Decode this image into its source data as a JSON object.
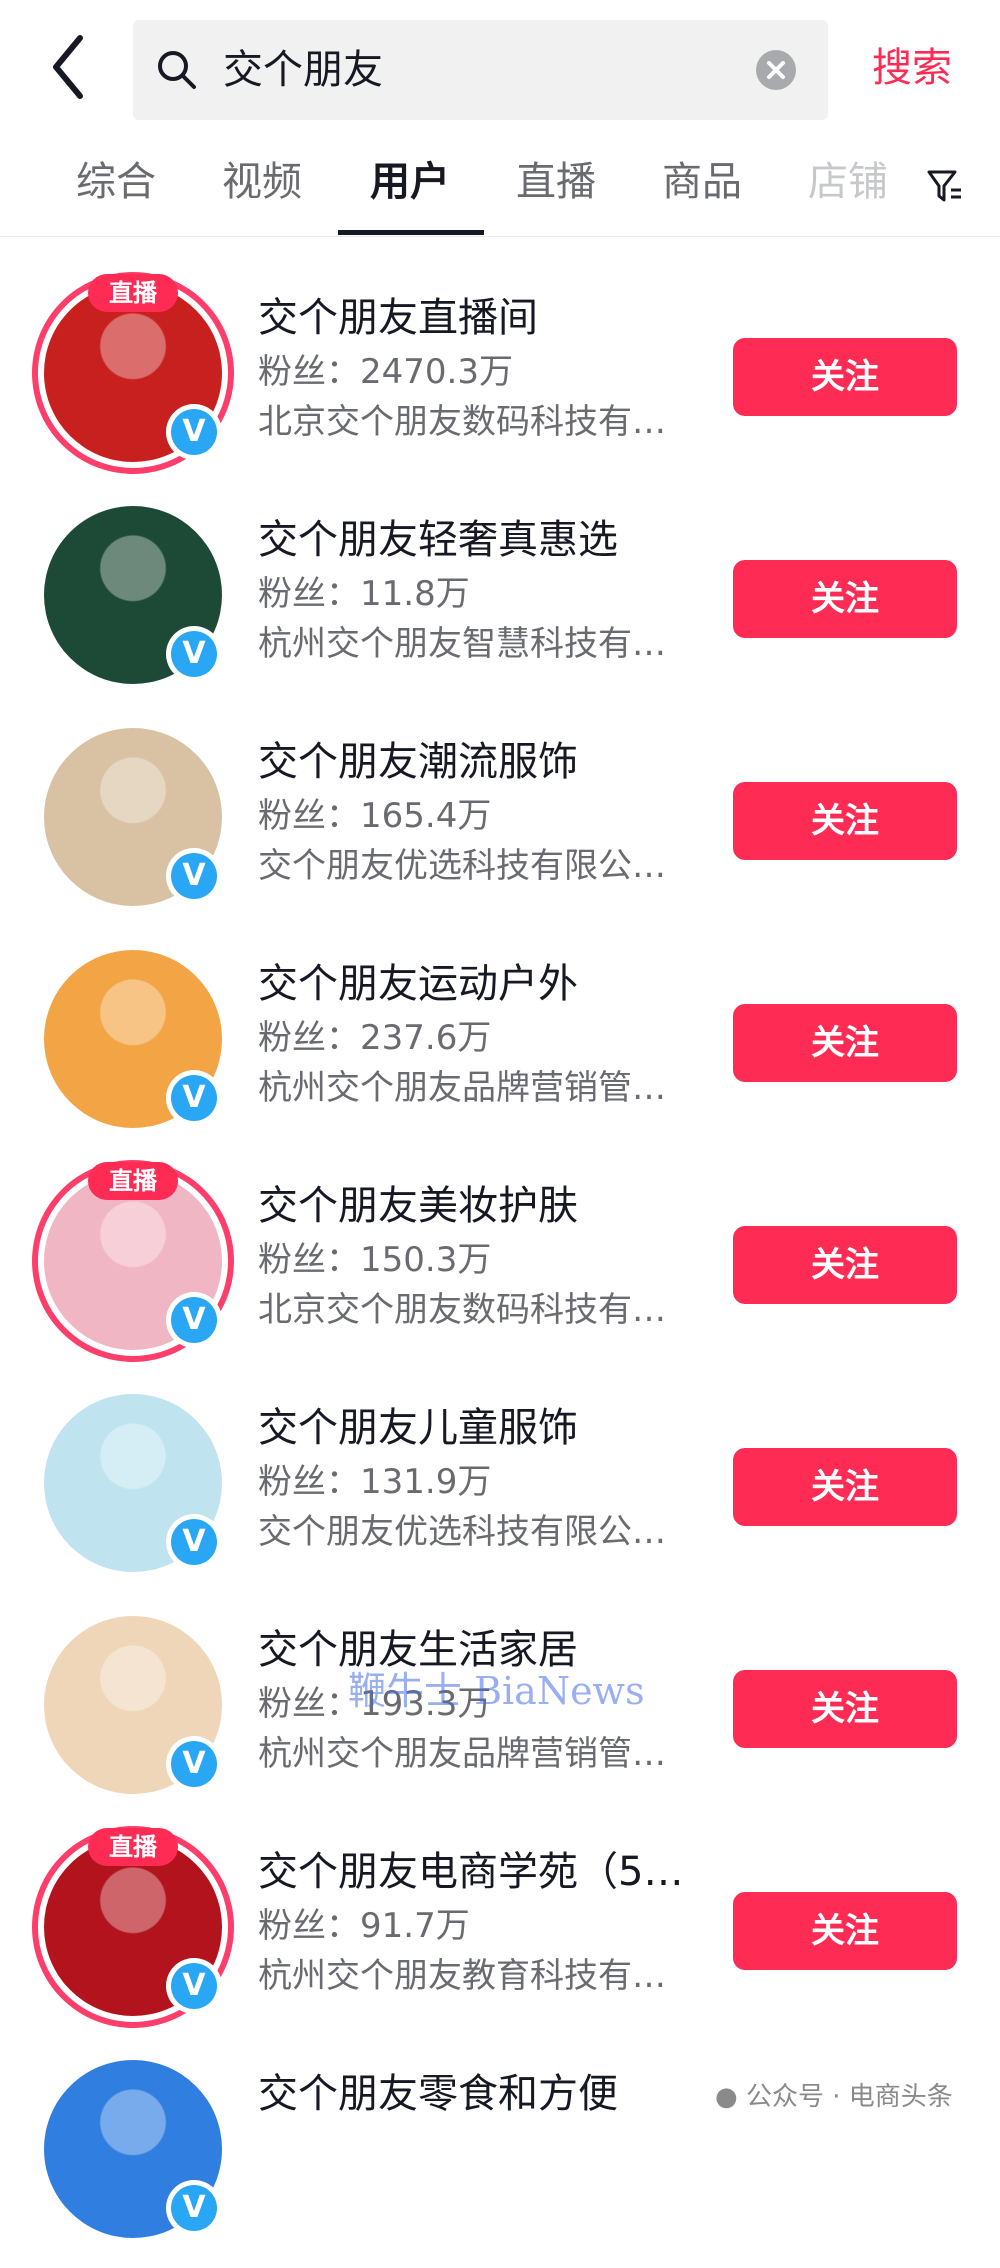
{
  "header": {
    "back_icon": "back-chevron-icon",
    "search_value": "交个朋友",
    "search_button": "搜索"
  },
  "tabs": [
    {
      "label": "综合"
    },
    {
      "label": "视频"
    },
    {
      "label": "用户"
    },
    {
      "label": "直播"
    },
    {
      "label": "商品"
    },
    {
      "label": "店铺"
    }
  ],
  "active_tab": "用户",
  "results": [
    {
      "name": "交个朋友直播间",
      "fans": "粉丝：2470.3万",
      "company": "北京交个朋友数码科技有…",
      "live": "直播",
      "button": "关注",
      "avatar_color": "#c8201e"
    },
    {
      "name": "交个朋友轻奢真惠选",
      "fans": "粉丝：11.8万",
      "company": "杭州交个朋友智慧科技有…",
      "live": "",
      "button": "关注",
      "avatar_color": "#1d4a36"
    },
    {
      "name": "交个朋友潮流服饰",
      "fans": "粉丝：165.4万",
      "company": "交个朋友优选科技有限公…",
      "live": "",
      "button": "关注",
      "avatar_color": "#d9c2a3"
    },
    {
      "name": "交个朋友运动户外",
      "fans": "粉丝：237.6万",
      "company": "杭州交个朋友品牌营销管…",
      "live": "",
      "button": "关注",
      "avatar_color": "#f3a445"
    },
    {
      "name": "交个朋友美妆护肤",
      "fans": "粉丝：150.3万",
      "company": "北京交个朋友数码科技有…",
      "live": "直播",
      "button": "关注",
      "avatar_color": "#f1b6c4"
    },
    {
      "name": "交个朋友儿童服饰",
      "fans": "粉丝：131.9万",
      "company": "交个朋友优选科技有限公…",
      "live": "",
      "button": "关注",
      "avatar_color": "#bfe3ef"
    },
    {
      "name": "交个朋友生活家居",
      "fans": "粉丝：193.3万",
      "company": "杭州交个朋友品牌营销管…",
      "live": "",
      "button": "关注",
      "avatar_color": "#efd6b8"
    },
    {
      "name": "交个朋友电商学苑（5…",
      "fans": "粉丝：91.7万",
      "company": "杭州交个朋友教育科技有…",
      "live": "直播",
      "button": "关注",
      "avatar_color": "#b3131c"
    },
    {
      "name": "交个朋友零食和方便",
      "fans": "",
      "company": "",
      "live": "",
      "button": "",
      "avatar_color": "#2f7ee0"
    }
  ],
  "verified_icon": "V",
  "watermark": "鞭牛士 BiaNews",
  "footer_watermark": "公众号 · 电商头条"
}
